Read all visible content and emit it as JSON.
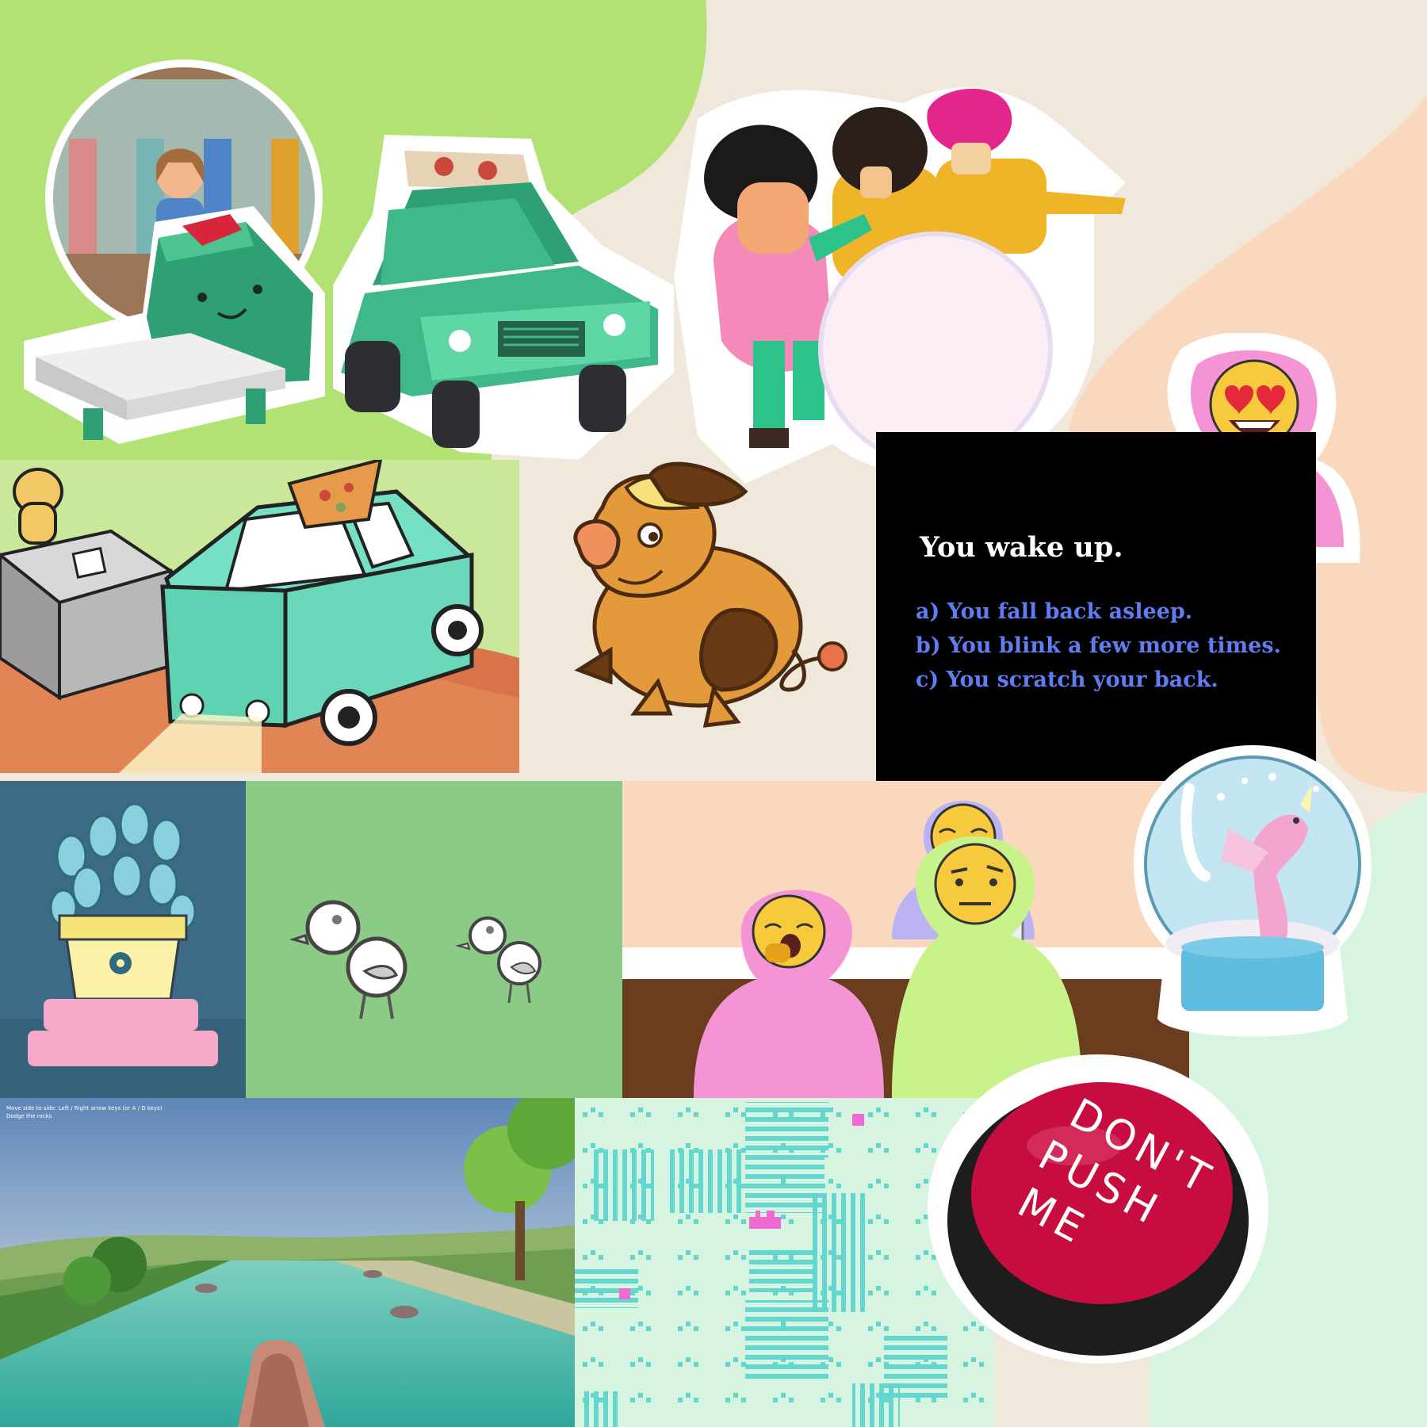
{
  "colors": {
    "green_blob": "#b2e274",
    "cream": "#f1e8dc",
    "peach": "#fad8bd",
    "mint": "#d7f4e1",
    "story_bg": "#000000",
    "story_heading": "#ffffff",
    "story_choice": "#5f7cf0",
    "sticker_border": "#ffffff"
  },
  "icons": [
    "shop-window-circle-sticker",
    "robot-pizza-box-sticker",
    "pizza-delivery-truck-sticker",
    "snowball-kids-sticker",
    "pizza-car-drawing",
    "pig-dog-doodle",
    "heart-eyes-avatar-sticker",
    "potted-plant-tile",
    "two-birds-tile",
    "sleepy-emoji-avatars-scene",
    "unicorn-snow-globe-sticker",
    "river-boat-3d-scene",
    "pixel-maze-tile",
    "dont-push-me-button-sticker"
  ],
  "text_adventure": {
    "heading": "You wake up.",
    "choices": [
      "a) You fall back asleep.",
      "b) You blink a few more times.",
      "c) You scratch your back."
    ]
  },
  "river_game": {
    "instructions": [
      "Move side to side: Left / Right arrow keys (or A / D keys)",
      "Dodge the rocks"
    ]
  },
  "button": {
    "label_line1": "DON'T",
    "label_line2": "PUSH",
    "label_line3": "ME",
    "color": "#c70c40"
  }
}
